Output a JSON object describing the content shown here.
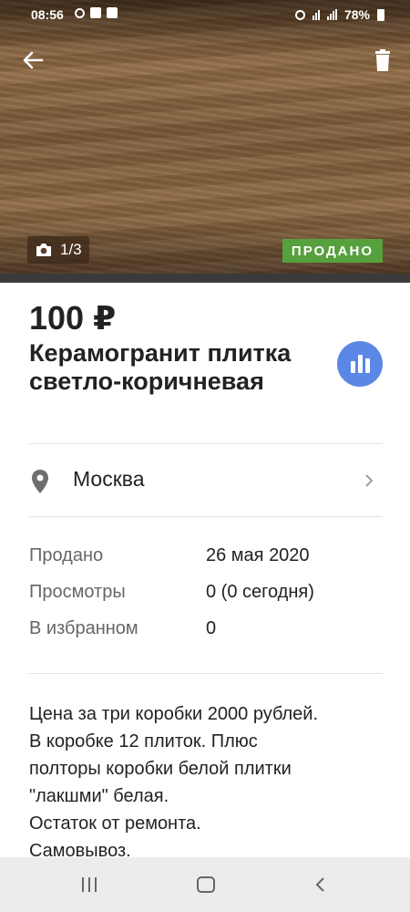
{
  "status_bar": {
    "time": "08:56",
    "battery": "78%"
  },
  "hero": {
    "photo_counter": "1/3",
    "sold_badge": "ПРОДАНО"
  },
  "listing": {
    "price": "100 ₽",
    "title": "Керамогранит плитка светло-коричневая",
    "location": "Москва"
  },
  "info": [
    {
      "label": "Продано",
      "value": "26 мая 2020"
    },
    {
      "label": "Просмотры",
      "value": "0 (0 сегодня)"
    },
    {
      "label": "В избранном",
      "value": "0"
    }
  ],
  "description": "Цена за три коробки 2000 рублей.\nВ коробке 12 плиток. Плюс\nполторы коробки белой плитки\n\"лакшми\" белая.\nОстаток от ремонта.\nСамовывоз.",
  "icons": [
    "back-arrow-icon",
    "trash-icon",
    "camera-icon",
    "stats-icon",
    "location-pin-icon",
    "chevron-right-icon"
  ],
  "colors": {
    "sold_badge": "#57a03e",
    "stats_button": "#5b87e6"
  }
}
